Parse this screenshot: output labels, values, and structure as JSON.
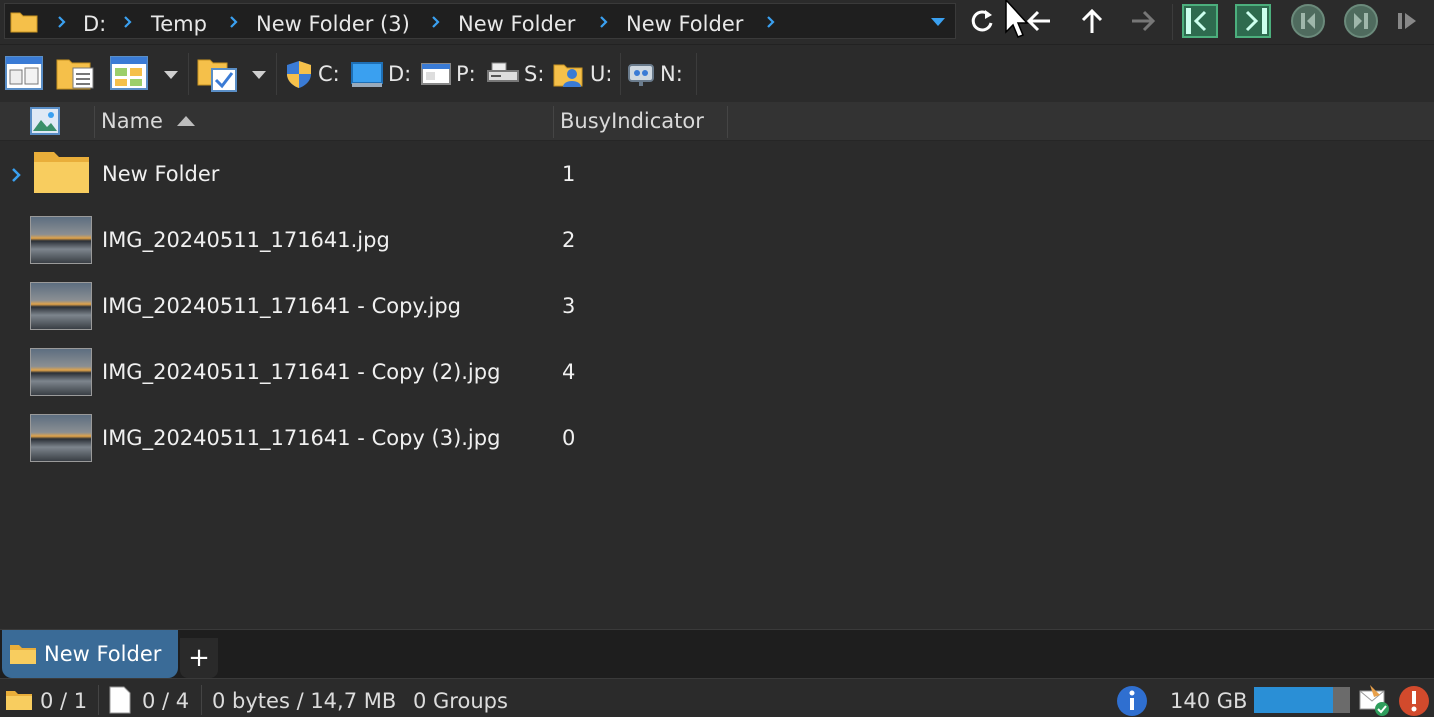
{
  "address": {
    "crumbs": [
      "D:",
      "Temp",
      "New Folder (3)",
      "New Folder",
      "New Folder"
    ]
  },
  "drives": [
    {
      "label": "C:",
      "icon": "shield-drive-icon"
    },
    {
      "label": "D:",
      "icon": "monitor-drive-icon"
    },
    {
      "label": "P:",
      "icon": "window-drive-icon"
    },
    {
      "label": "S:",
      "icon": "scanner-drive-icon"
    },
    {
      "label": "U:",
      "icon": "user-folder-icon"
    },
    {
      "label": "N:",
      "icon": "network-drive-icon"
    }
  ],
  "columns": {
    "name": "Name",
    "busy": "BusyIndicator"
  },
  "rows": [
    {
      "name": "New Folder",
      "value": "1",
      "type": "folder"
    },
    {
      "name": "IMG_20240511_171641.jpg",
      "value": "2",
      "type": "image"
    },
    {
      "name": "IMG_20240511_171641 - Copy.jpg",
      "value": "3",
      "type": "image"
    },
    {
      "name": "IMG_20240511_171641 - Copy (2).jpg",
      "value": "4",
      "type": "image"
    },
    {
      "name": "IMG_20240511_171641 - Copy (3).jpg",
      "value": "0",
      "type": "image"
    }
  ],
  "tabs": {
    "active": "New Folder",
    "add": "+"
  },
  "status": {
    "folders": "0 / 1",
    "files": "0 / 4",
    "size": "0 bytes / 14,7 MB",
    "groups": "0 Groups",
    "free": "140 GB",
    "free_fraction": 0.82
  },
  "colors": {
    "accent": "#3a6b97",
    "folder": "#f5c04a",
    "chevron": "#3aa0f0",
    "nav_green": "#4caf7d"
  }
}
